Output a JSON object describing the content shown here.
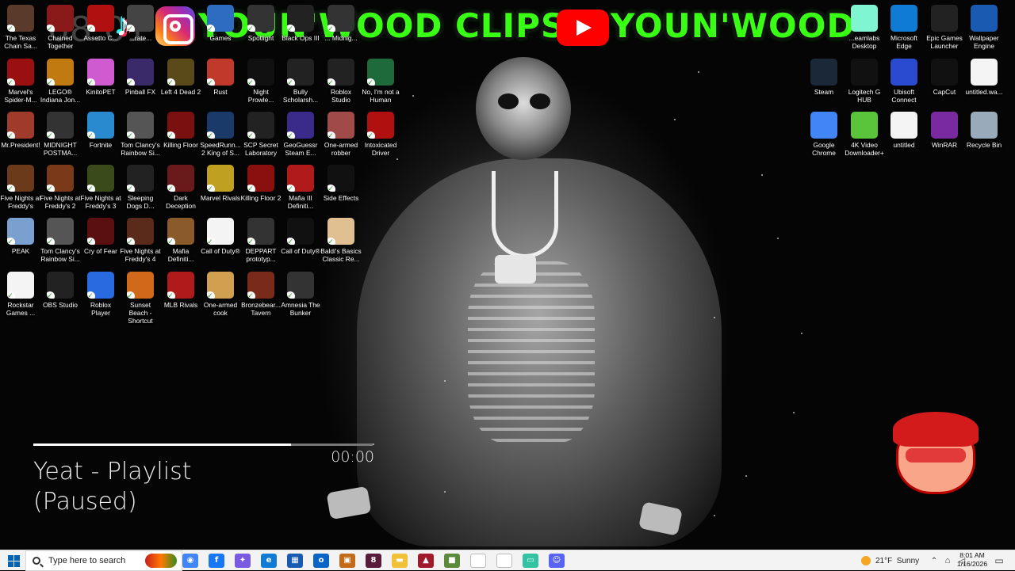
{
  "banner": {
    "text_left": "YOUN'WOOD CLIPS",
    "text_right": "YOUN'WOOD",
    "clock_ghost": "08:01"
  },
  "desktop_icons": [
    {
      "label": "The Texas Chain Sa...",
      "icon": "texas-chainsaw-icon",
      "color": "#5a3a2a"
    },
    {
      "label": "Chained Together",
      "icon": "chained-together-icon",
      "color": "#8a1a1a"
    },
    {
      "label": "Assetto C...",
      "icon": "assetto-corsa-icon",
      "color": "#b01010"
    },
    {
      "label": "...rate...",
      "icon": "game-icon",
      "color": "#444"
    },
    {
      "label": "Games",
      "icon": "folder-icon",
      "color": "#2d6cc0"
    },
    {
      "label": "Spotlight",
      "icon": "spotlight-icon",
      "color": "#333"
    },
    {
      "label": "Black Ops III",
      "icon": "black-ops-icon",
      "color": "#222"
    },
    {
      "label": "... Midnig...",
      "icon": "game-icon",
      "color": "#333"
    },
    {
      "label": "Marvel's Spider-M...",
      "icon": "spiderman-icon",
      "color": "#9a1010"
    },
    {
      "label": "LEGO® Indiana Jon...",
      "icon": "lego-icon",
      "color": "#c07a10"
    },
    {
      "label": "KinitoPET",
      "icon": "kinito-icon",
      "color": "#d05ad0"
    },
    {
      "label": "Pinball FX",
      "icon": "pinball-icon",
      "color": "#3a2a6a"
    },
    {
      "label": "Left 4 Dead 2",
      "icon": "left4dead-icon",
      "color": "#5a4a1a"
    },
    {
      "label": "Rust",
      "icon": "rust-icon",
      "color": "#c0392b"
    },
    {
      "label": "Night Prowle...",
      "icon": "night-prowler-icon",
      "color": "#111"
    },
    {
      "label": "Bully Scholarsh...",
      "icon": "bully-icon",
      "color": "#222"
    },
    {
      "label": "Roblox Studio",
      "icon": "roblox-studio-icon",
      "color": "#222"
    },
    {
      "label": "No, I'm not a Human",
      "icon": "not-human-icon",
      "color": "#1e6a3a"
    },
    {
      "label": "Mr.President!",
      "icon": "mr-president-icon",
      "color": "#a03a2a"
    },
    {
      "label": "MIDNIGHT POSTMA...",
      "icon": "midnight-postman-icon",
      "color": "#333"
    },
    {
      "label": "Fortnite",
      "icon": "fortnite-icon",
      "color": "#2a8ad0"
    },
    {
      "label": "Tom Clancy's Rainbow Si...",
      "icon": "rainbow-six-icon",
      "color": "#555"
    },
    {
      "label": "Killing Floor",
      "icon": "killing-floor-icon",
      "color": "#7a1010"
    },
    {
      "label": "SpeedRunn... 2 King of S...",
      "icon": "speedrunners-icon",
      "color": "#1a3a6a"
    },
    {
      "label": "SCP Secret Laboratory",
      "icon": "scp-icon",
      "color": "#222"
    },
    {
      "label": "GeoGuessr Steam E...",
      "icon": "geoguessr-icon",
      "color": "#3a2a8a"
    },
    {
      "label": "One-armed robber",
      "icon": "one-armed-robber-icon",
      "color": "#a04a4a"
    },
    {
      "label": "Intoxicated Driver",
      "icon": "intoxicated-driver-icon",
      "color": "#b01010"
    },
    {
      "label": "Five Nights at Freddy's",
      "icon": "fnaf-icon",
      "color": "#6a3a1a"
    },
    {
      "label": "Five Nights at Freddy's 2",
      "icon": "fnaf2-icon",
      "color": "#7a3a1a"
    },
    {
      "label": "Five Nights at Freddy's 3",
      "icon": "fnaf3-icon",
      "color": "#3a4a1a"
    },
    {
      "label": "Sleeping Dogs D...",
      "icon": "sleeping-dogs-icon",
      "color": "#222"
    },
    {
      "label": "Dark Deception",
      "icon": "dark-deception-icon",
      "color": "#6a1a1a"
    },
    {
      "label": "Marvel Rivals",
      "icon": "marvel-rivals-icon",
      "color": "#c0a020"
    },
    {
      "label": "Killing Floor 2",
      "icon": "killing-floor2-icon",
      "color": "#8a1010"
    },
    {
      "label": "Mafia III Definiti...",
      "icon": "mafia3-icon",
      "color": "#b01a1a"
    },
    {
      "label": "Side Effects",
      "icon": "side-effects-icon",
      "color": "#111"
    },
    {
      "label": "PEAK",
      "icon": "peak-icon",
      "color": "#7aa0d0"
    },
    {
      "label": "Tom Clancy's Rainbow Si...",
      "icon": "rainbow-six-icon",
      "color": "#555"
    },
    {
      "label": "Cry of Fear",
      "icon": "cry-of-fear-icon",
      "color": "#5a1010"
    },
    {
      "label": "Five Nights at Freddy's 4",
      "icon": "fnaf4-icon",
      "color": "#5a2a1a"
    },
    {
      "label": "Mafia Definiti...",
      "icon": "mafia-icon",
      "color": "#8a5a2a"
    },
    {
      "label": "Call of Duty®",
      "icon": "file-icon",
      "color": "#f4f4f4"
    },
    {
      "label": "DEPPART prototyp...",
      "icon": "deppart-icon",
      "color": "#333"
    },
    {
      "label": "Call of Duty®",
      "icon": "call-of-duty-icon",
      "color": "#111"
    },
    {
      "label": "Baldi's Basics Classic Re...",
      "icon": "baldi-icon",
      "color": "#e0c090"
    },
    {
      "label": "Rockstar Games ...",
      "icon": "file-icon",
      "color": "#f4f4f4"
    },
    {
      "label": "OBS Studio",
      "icon": "obs-icon",
      "color": "#222"
    },
    {
      "label": "Roblox Player",
      "icon": "roblox-icon",
      "color": "#2a6ae0"
    },
    {
      "label": "Sunset Beach - Shortcut",
      "icon": "sunset-beach-icon",
      "color": "#d06a1a"
    },
    {
      "label": "MLB Rivals",
      "icon": "mlb-rivals-icon",
      "color": "#b01a1a"
    },
    {
      "label": "One-armed cook",
      "icon": "one-armed-cook-icon",
      "color": "#d0a050"
    },
    {
      "label": "Bronzebear... Tavern",
      "icon": "bronzebeard-icon",
      "color": "#7a2a1a"
    },
    {
      "label": "Amnesia The Bunker",
      "icon": "amnesia-icon",
      "color": "#333"
    }
  ],
  "right_icons": [
    {
      "label": "...eamlabs Desktop",
      "icon": "streamlabs-icon",
      "color": "#80f5d2"
    },
    {
      "label": "Microsoft Edge",
      "icon": "edge-icon",
      "color": "#0f7bd4"
    },
    {
      "label": "Epic Games Launcher",
      "icon": "epic-games-icon",
      "color": "#222"
    },
    {
      "label": "Wallpaper Engine",
      "icon": "wallpaper-engine-icon",
      "color": "#1a5ab0"
    },
    {
      "label": "Steam",
      "icon": "steam-icon",
      "color": "#1b2838"
    },
    {
      "label": "Logitech G HUB",
      "icon": "logitech-icon",
      "color": "#111"
    },
    {
      "label": "Ubisoft Connect",
      "icon": "ubisoft-icon",
      "color": "#2a4ad0"
    },
    {
      "label": "CapCut",
      "icon": "capcut-icon",
      "color": "#111"
    },
    {
      "label": "untitled.wa...",
      "icon": "file-icon",
      "color": "#f4f4f4"
    },
    {
      "label": "Google Chrome",
      "icon": "chrome-icon",
      "color": "#4285f4"
    },
    {
      "label": "4K Video Downloader+",
      "icon": "4k-downloader-icon",
      "color": "#5ac43a"
    },
    {
      "label": "untitled",
      "icon": "file-icon",
      "color": "#f4f4f4"
    },
    {
      "label": "WinRAR",
      "icon": "winrar-icon",
      "color": "#7a2aa0"
    },
    {
      "label": "Recycle Bin",
      "icon": "recycle-bin-icon",
      "color": "#9ab"
    }
  ],
  "music": {
    "title": "Yeat - Playlist",
    "state": "(Paused)",
    "time": "00:00",
    "progress": 0.76
  },
  "taskbar": {
    "search_placeholder": "Type here to search",
    "apps": [
      {
        "icon": "chrome-icon",
        "color": "#4285f4",
        "glyph": "◉"
      },
      {
        "icon": "facebook-icon",
        "color": "#1877f2",
        "glyph": "f"
      },
      {
        "icon": "copilot-icon",
        "color": "#7a5ae0",
        "glyph": "✦"
      },
      {
        "icon": "edge-icon",
        "color": "#0f7bd4",
        "glyph": "e"
      },
      {
        "icon": "calculator-icon",
        "color": "#1a5ab0",
        "glyph": "▦"
      },
      {
        "icon": "outlook-icon",
        "color": "#0a64c8",
        "glyph": "o"
      },
      {
        "icon": "game-icon",
        "color": "#c06a1a",
        "glyph": "▣"
      },
      {
        "icon": "game-icon",
        "color": "#5a1a3a",
        "glyph": "8"
      },
      {
        "icon": "file-explorer-icon",
        "color": "#f2c13a",
        "glyph": "▬"
      },
      {
        "icon": "game-icon",
        "color": "#a01a2a",
        "glyph": "▲"
      },
      {
        "icon": "minecraft-icon",
        "color": "#5a8a3a",
        "glyph": "■"
      },
      {
        "icon": "notepad-icon",
        "color": "#ffffff",
        "glyph": ""
      },
      {
        "icon": "notepad-icon",
        "color": "#ffffff",
        "glyph": ""
      },
      {
        "icon": "streamlabs-icon",
        "color": "#31c3a2",
        "glyph": "▭"
      },
      {
        "icon": "discord-icon",
        "color": "#5865f2",
        "glyph": "☺"
      }
    ],
    "weather_temp": "21°F",
    "weather_cond": "Sunny",
    "time": "8:01 AM",
    "date": "1/16/2026"
  }
}
